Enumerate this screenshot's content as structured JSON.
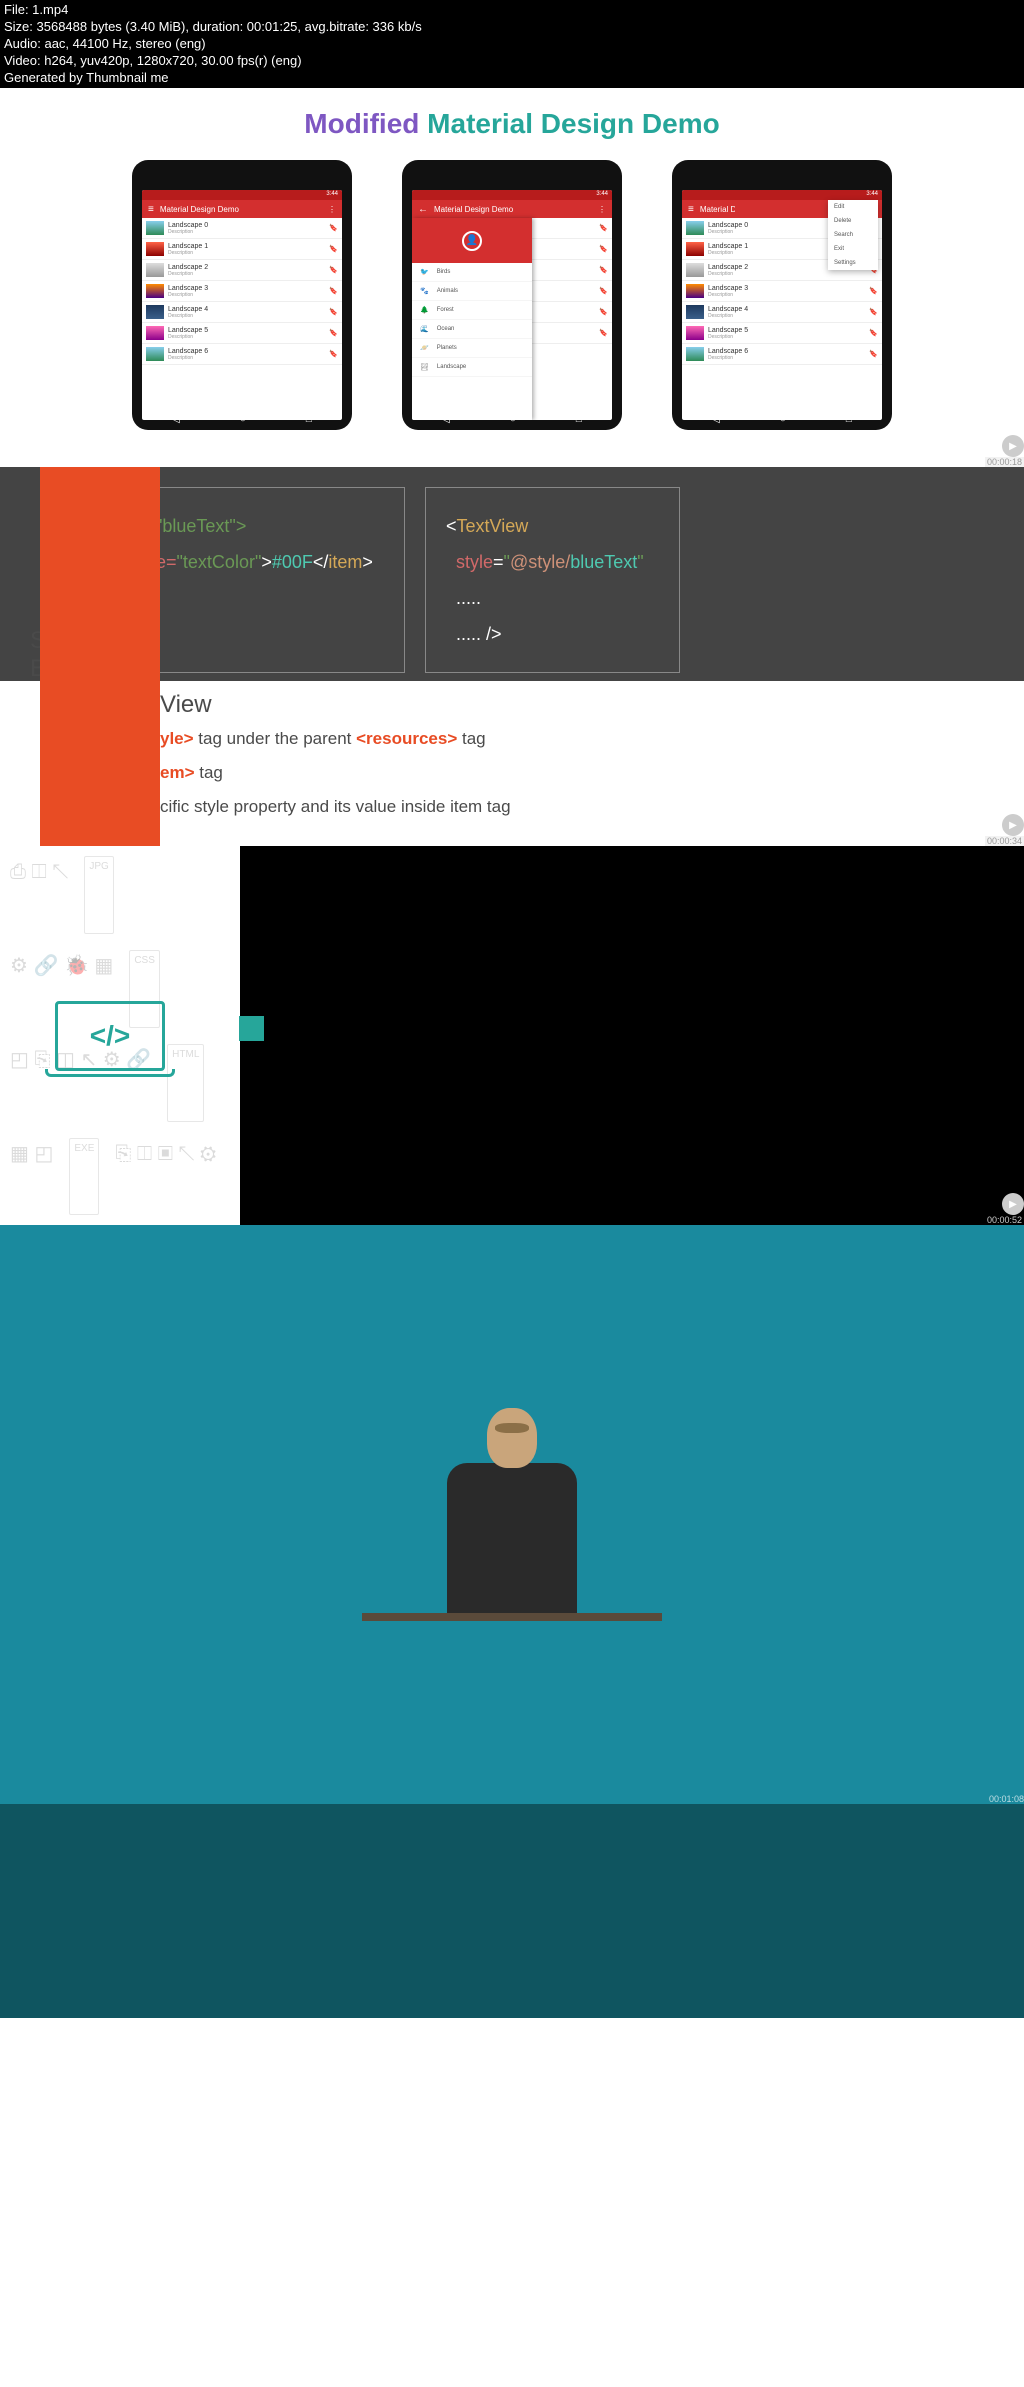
{
  "header": {
    "file": "File: 1.mp4",
    "size": "Size: 3568488 bytes (3.40 MiB), duration: 00:01:25, avg.bitrate: 336 kb/s",
    "audio": "Audio: aac, 44100 Hz, stereo (eng)",
    "video": "Video: h264, yuv420p, 1280x720, 30.00 fps(r) (eng)",
    "generated": "Generated by Thumbnail me"
  },
  "section1": {
    "title_modified": "Modified",
    "title_rest": " Material Design Demo",
    "status_time": "3:44",
    "app_title": "Material Design Demo",
    "items": [
      "Landscape 0",
      "Landscape 1",
      "Landscape 2",
      "Landscape 3",
      "Landscape 4",
      "Landscape 5",
      "Landscape 6"
    ],
    "desc": "Description",
    "drawer_items": [
      "Birds",
      "Animals",
      "Forest",
      "Ocean",
      "Planets",
      "Landscape"
    ],
    "popup_items": [
      "Edit",
      "Delete",
      "Search",
      "Exit",
      "Settings"
    ],
    "timestamp": "00:00:18"
  },
  "section2": {
    "code1_l1": "\"blueText\">",
    "code1_l2a": "e=",
    "code1_l2b": "\"textColor\"",
    "code1_l2c": ">",
    "code1_l2d": "#00F",
    "code1_l2e": "</",
    "code1_l2f": "item",
    "code1_l2g": ">",
    "code2_l1": "<",
    "code2_l1b": "TextView",
    "code2_l2a": "style",
    "code2_l2b": "=",
    "code2_l2c": "\"",
    "code2_l2d": "@style/",
    "code2_l2e": "blueText",
    "code2_l2f": "\"",
    "code2_l3": ".....",
    "code2_l4": "..... />",
    "side_sty": "Sty",
    "side_bas": "Bas",
    "view": "View",
    "line1a": "yle>",
    "line1b": " tag under the parent ",
    "line1c": "<resources>",
    "line1d": " tag",
    "line2a": "em>",
    "line2b": " tag",
    "line3": "cific style property and its value inside item tag",
    "timestamp": "00:00:34"
  },
  "section3": {
    "code_symbol": "</>",
    "pattern_labels": [
      "JPG",
      "CSS",
      "HTML",
      "EXE"
    ],
    "timestamp": "00:00:52"
  },
  "section4": {
    "timestamp": "00:01:08"
  }
}
